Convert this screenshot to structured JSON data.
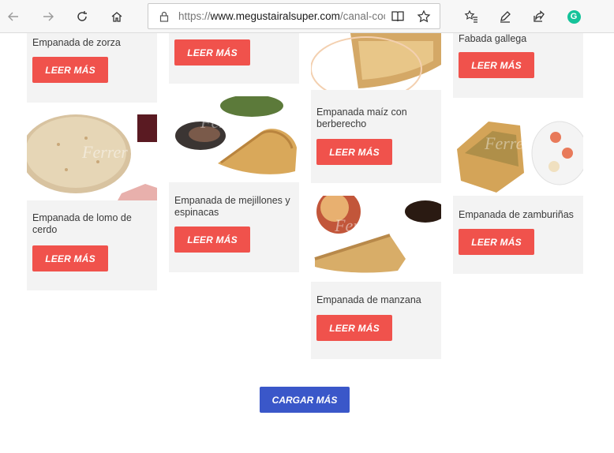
{
  "browser": {
    "url_prefix": "https://",
    "url_domain": "www.megustairalsuper.com",
    "url_path": "/canal-coc",
    "extension_badge": "G"
  },
  "cards": [
    {
      "title": "Empanada de zorza",
      "button": "LEER MÁS"
    },
    {
      "title": "",
      "button": "LEER MÁS"
    },
    {
      "title": "Fabada gallega",
      "button": "LEER MÁS"
    },
    {
      "title": "Empanada de lomo de cerdo",
      "button": "LEER MÁS"
    },
    {
      "title": "Empanada de mejillones y espinacas",
      "button": "LEER MÁS"
    },
    {
      "title": "Empanada maíz con berberecho",
      "button": "LEER MÁS"
    },
    {
      "title": "Empanada de zamburiñas",
      "button": "LEER MÁS"
    },
    {
      "title": "Empanada de manzana",
      "button": "LEER MÁS"
    }
  ],
  "load_more": "CARGAR MÁS",
  "colors": {
    "read_more": "#f0524c",
    "load_more": "#3a57c9",
    "card_bg": "#f3f3f3"
  }
}
